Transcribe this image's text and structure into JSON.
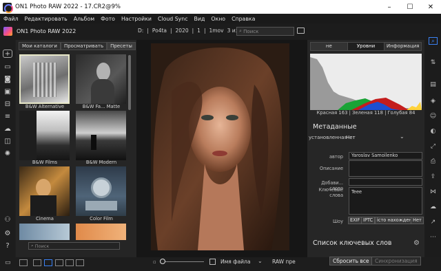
{
  "window": {
    "title": "ON1 Photo RAW 2022 - 17.CR2@9%",
    "controls": [
      "–",
      "☐",
      "✕"
    ]
  },
  "menu": [
    "Файл",
    "Редактировать",
    "Альбом",
    "Фото",
    "Настройки",
    "Cloud Sync",
    "Вид",
    "Окно",
    "Справка"
  ],
  "app": {
    "name": "ON1 Photo RAW 2022"
  },
  "path": {
    "drive": "D:",
    "segments": [
      "Po4ta",
      "2020",
      "1",
      "1mov"
    ],
    "counter": "3 из9",
    "search_placeholder": "Поиск"
  },
  "browser": {
    "tabs": [
      "Мои каталоги",
      "Просматривать",
      "Пресеты"
    ],
    "presets": [
      "B&W Alternative",
      "B&W Fa... Matte",
      "B&W Films",
      "B&W Modern",
      "Cinema",
      "Color Film"
    ],
    "search_placeholder": "Поиск"
  },
  "right_panel": {
    "tabs": [
      "не",
      "Уровни",
      "Информация"
    ],
    "histogram_readout": "Красная 163 | Зеленая 118 | Голубая 84",
    "metadata": {
      "title": "Метаданные",
      "preset_label": "установленная",
      "preset_value": "Нет",
      "author_label": "автор",
      "author_value": "Yaroslav Samoilenko",
      "description_label": "Описание",
      "add_keywords_label": "Добави... слово",
      "keywords_label": "Ключевые слова",
      "keywords_value": "Teee",
      "show_label": "Шоу",
      "show_chips": [
        "EXIF",
        "IPTC",
        "істо нахожден",
        "Нет"
      ]
    },
    "keyword_list_title": "Список ключевых слов"
  },
  "bottom": {
    "filename_label": "Имя файла",
    "raw_label": "RAW пре",
    "reset_all": "Сбросить все",
    "sync": "Синхронизация"
  },
  "colors": {
    "accent": "#3b82f6",
    "selected_border": "#e8e8c8"
  }
}
